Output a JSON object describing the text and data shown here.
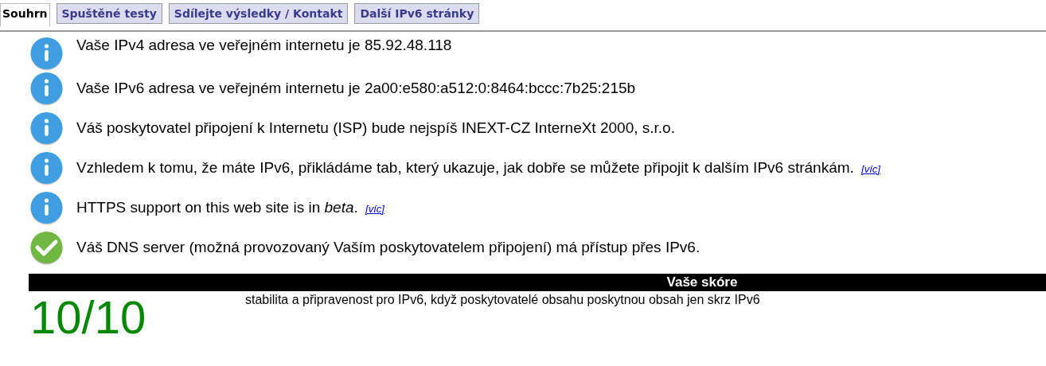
{
  "tabs": [
    {
      "label": "Souhrn",
      "selected": true
    },
    {
      "label": "Spuštěné testy",
      "selected": false
    },
    {
      "label": "Sdílejte výsledky / Kontakt",
      "selected": false
    },
    {
      "label": "Další IPv6 stránky",
      "selected": false
    }
  ],
  "results": [
    {
      "kind": "info",
      "text": "Vaše IPv4 adresa ve veřejném internetu je 85.92.48.118"
    },
    {
      "kind": "info",
      "text": "Vaše IPv6 adresa ve veřejném internetu je 2a00:e580:a512:0:8464:bccc:7b25:215b"
    },
    {
      "kind": "info",
      "text": "Váš poskytovatel připojení k Internetu (ISP) bude nejspíš INEXT-CZ InterneXt 2000, s.r.o."
    },
    {
      "kind": "info",
      "text": "Vzhledem k tomu, že máte IPv6, přikládáme tab, který ukazuje, jak dobře se můžete připojit k dalším IPv6 stránkám.",
      "link": "[víc]"
    },
    {
      "kind": "info",
      "text": "HTTPS support on this web site is in *beta*.",
      "link": "[víc]"
    },
    {
      "kind": "ok",
      "text": "Váš DNS server (možná provozovaný Vaším poskytovatelem připojení) má přístup přes IPv6."
    }
  ],
  "score": {
    "title": "Vaše skóre",
    "value": "10/10",
    "description": "stabilita a připravenost pro IPv6, když poskytovatelé obsahu poskytnou obsah jen skrz IPv6"
  }
}
